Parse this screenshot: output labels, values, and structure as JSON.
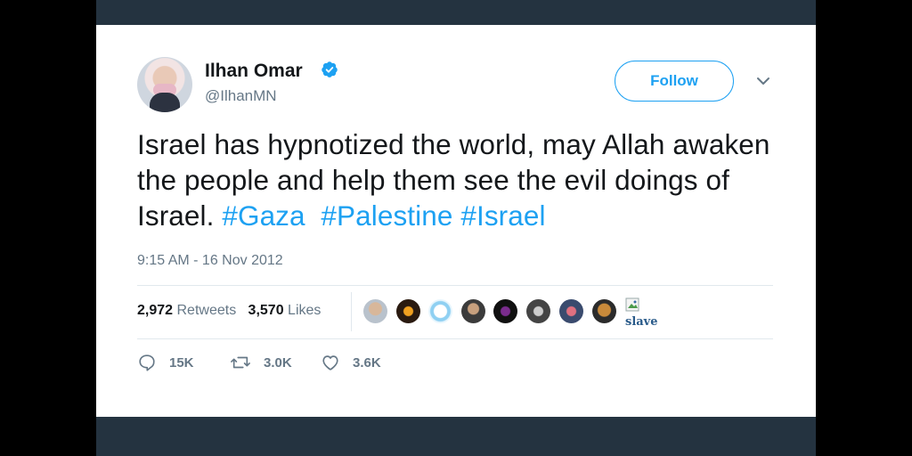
{
  "tweet": {
    "author_name": "Ilhan Omar",
    "handle": "@IlhanMN",
    "follow_label": "Follow",
    "text_plain": "Israel has hypnotized the world, may Allah awaken the people and help them see the evil doings of Israel. ",
    "hashtags": [
      "#Gaza",
      "#Palestine",
      "#Israel"
    ],
    "timestamp": "9:15 AM - 16 Nov 2012"
  },
  "stats": {
    "retweets_count": "2,972",
    "retweets_label": "Retweets",
    "likes_count": "3,570",
    "likes_label": "Likes"
  },
  "facepile": {
    "broken_image_alt": "slave"
  },
  "actions": {
    "replies": "15K",
    "retweets": "3.0K",
    "likes": "3.6K"
  },
  "colors": {
    "accent": "#1da1f2",
    "text": "#14171a",
    "secondary": "#657786",
    "frame": "#243340"
  },
  "icons": [
    "verified-badge-icon",
    "chevron-down-icon",
    "reply-icon",
    "retweet-icon",
    "like-icon",
    "broken-image-icon"
  ]
}
